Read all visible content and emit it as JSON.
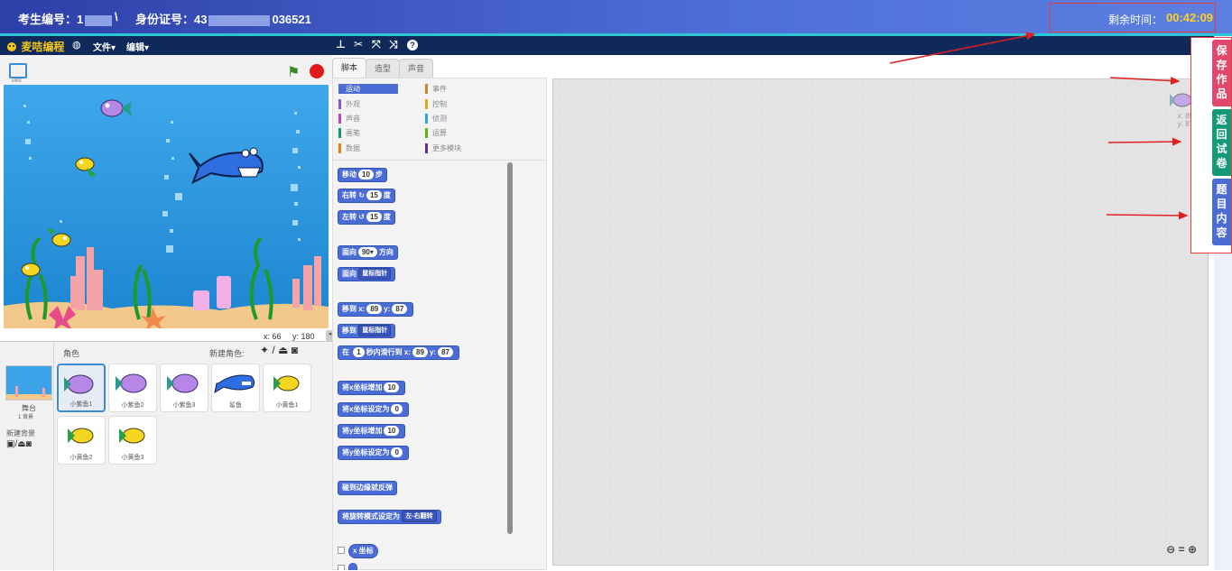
{
  "topbar": {
    "exam_label": "考生编号：1",
    "separator": "\\",
    "id_label": "身份证号：43",
    "id_suffix": "036521",
    "time_label": "剩余时间：",
    "time_value": "00:42:09"
  },
  "menubar": {
    "logo": "麦咭编程",
    "file": "文件▾",
    "edit": "编辑▾",
    "tool_icons": [
      "stamp-icon",
      "scissors-icon",
      "grow-icon",
      "shrink-icon",
      "help-icon"
    ]
  },
  "stage": {
    "version": "v466",
    "mouse_x_label": "x:",
    "mouse_x": "66",
    "mouse_y_label": "y:",
    "mouse_y": "180"
  },
  "sprites_panel": {
    "title": "角色",
    "new_sprite_label": "新建角色:",
    "backdrop_label": "舞台",
    "backdrop_count": "1 背景",
    "new_backdrop_label": "新建背景",
    "sprites": [
      "小紫鱼1",
      "小紫鱼2",
      "小紫鱼3",
      "鲨鱼",
      "小黄鱼1",
      "小黄鱼2",
      "小黄鱼3"
    ]
  },
  "tabs": [
    "脚本",
    "造型",
    "声音"
  ],
  "categories": [
    {
      "name": "运动",
      "color": "#4a6cd4"
    },
    {
      "name": "事件",
      "color": "#c88330"
    },
    {
      "name": "外观",
      "color": "#8a55d7"
    },
    {
      "name": "控制",
      "color": "#e1a91a"
    },
    {
      "name": "声音",
      "color": "#bb42c3"
    },
    {
      "name": "侦测",
      "color": "#2ca5e2"
    },
    {
      "name": "画笔",
      "color": "#0e9a6c"
    },
    {
      "name": "运算",
      "color": "#5cb712"
    },
    {
      "name": "数据",
      "color": "#ee7d16"
    },
    {
      "name": "更多模块",
      "color": "#632d99"
    }
  ],
  "blocks": {
    "move": {
      "pre": "移动",
      "num": "10",
      "post": "步"
    },
    "turn_right": {
      "pre": "右转",
      "num": "15",
      "post": "度"
    },
    "turn_left": {
      "pre": "左转",
      "num": "15",
      "post": "度"
    },
    "point_dir": {
      "pre": "面向",
      "num": "90▾",
      "post": "方向"
    },
    "point_towards": {
      "pre": "面向",
      "dd": "鼠标指针"
    },
    "goto_xy": {
      "pre": "移到 x:",
      "x": "89",
      "mid": "y:",
      "y": "87"
    },
    "goto": {
      "pre": "移到",
      "dd": "鼠标指针"
    },
    "glide": {
      "pre": "在",
      "secs": "1",
      "mid1": "秒内滑行到 x:",
      "x": "89",
      "mid2": "y:",
      "y": "87"
    },
    "change_x": {
      "pre": "将x坐标增加",
      "num": "10"
    },
    "set_x": {
      "pre": "将x坐标设定为",
      "num": "0"
    },
    "change_y": {
      "pre": "将y坐标增加",
      "num": "10"
    },
    "set_y": {
      "pre": "将y坐标设定为",
      "num": "0"
    },
    "bounce": {
      "pre": "碰到边缘就反弹"
    },
    "rotation": {
      "pre": "将旋转模式设定为",
      "dd": "左-右翻转"
    },
    "xpos": {
      "pre": "x 坐标"
    }
  },
  "script_area": {
    "x_label": "x: 89",
    "y_label": "y: 87",
    "zoom_out": "🔍",
    "zoom_reset": "=",
    "zoom_in": "🔍"
  },
  "side": {
    "save": "保存作品",
    "back": "返回试卷",
    "content": "题目内容"
  },
  "colors": {
    "save": "#e0476a",
    "back": "#139a78",
    "content": "#4a6cd4",
    "accent": "#3a8ad8"
  }
}
